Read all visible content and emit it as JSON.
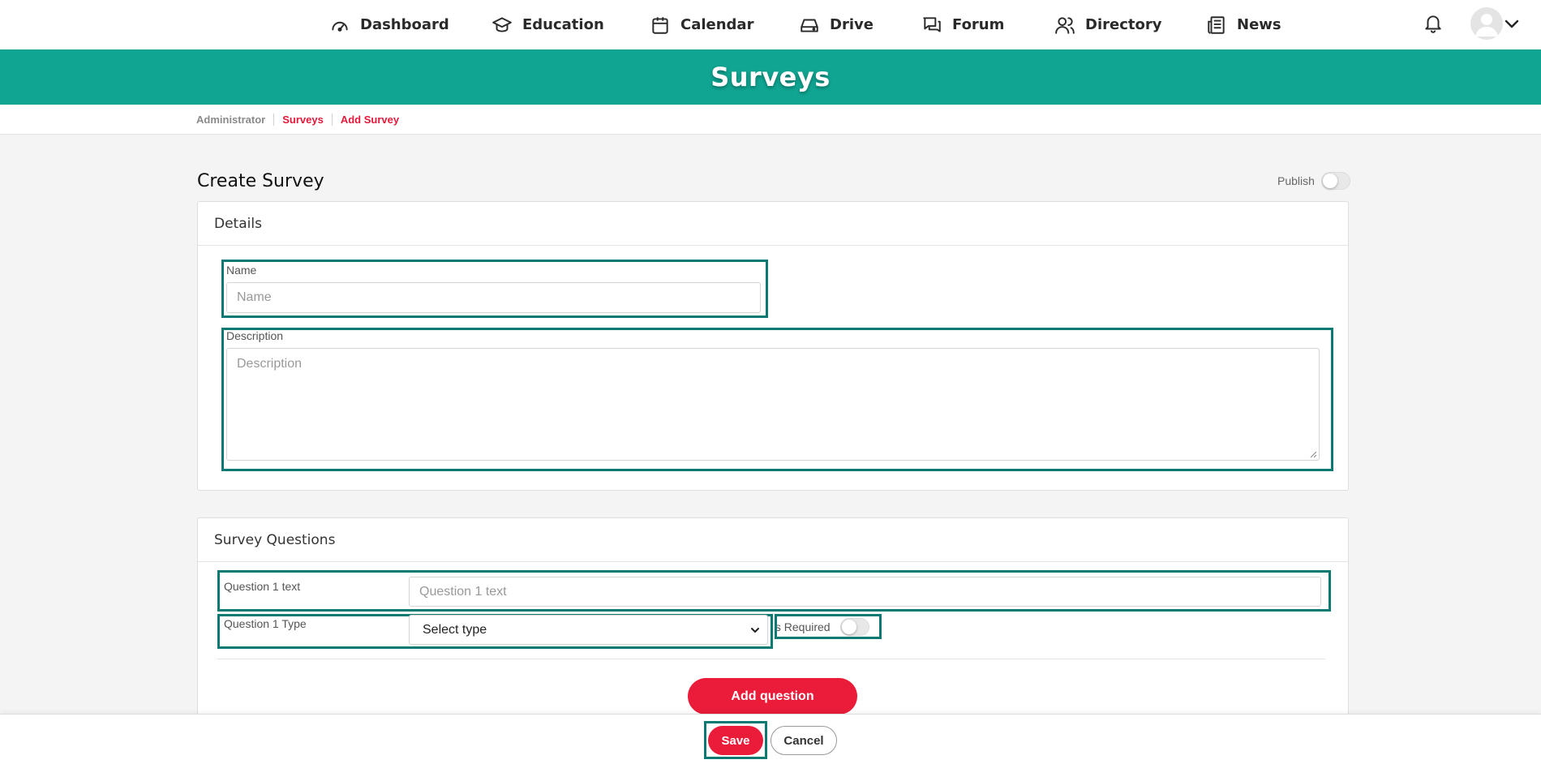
{
  "nav": {
    "items": [
      {
        "label": "Dashboard",
        "icon": "speedometer-icon"
      },
      {
        "label": "Education",
        "icon": "graduation-cap-icon"
      },
      {
        "label": "Calendar",
        "icon": "calendar-icon"
      },
      {
        "label": "Drive",
        "icon": "hard-drive-icon"
      },
      {
        "label": "Forum",
        "icon": "chat-bubbles-icon"
      },
      {
        "label": "Directory",
        "icon": "users-icon"
      },
      {
        "label": "News",
        "icon": "newspaper-icon"
      }
    ],
    "notification_icon": "bell-icon",
    "avatar_icon": "user-avatar-icon"
  },
  "banner": {
    "title": "Surveys",
    "color": "#10a592"
  },
  "breadcrumb": [
    "Administrator",
    "Surveys",
    "Add Survey"
  ],
  "page": {
    "title": "Create Survey",
    "publish_label": "Publish"
  },
  "details": {
    "header": "Details",
    "name_label": "Name",
    "name_placeholder": "Name",
    "description_label": "Description",
    "description_placeholder": "Description"
  },
  "questions": {
    "header": "Survey Questions",
    "q1_text_label": "Question 1 text",
    "q1_text_placeholder": "Question 1 text",
    "q1_type_label": "Question 1 Type",
    "q1_type_value": "Select type",
    "is_required_label": "Is Required",
    "add_button": "Add question"
  },
  "footer": {
    "save": "Save",
    "cancel": "Cancel"
  },
  "colors": {
    "accent": "#ea1c3a",
    "highlight": "#0c7a73",
    "teal": "#10a592"
  }
}
